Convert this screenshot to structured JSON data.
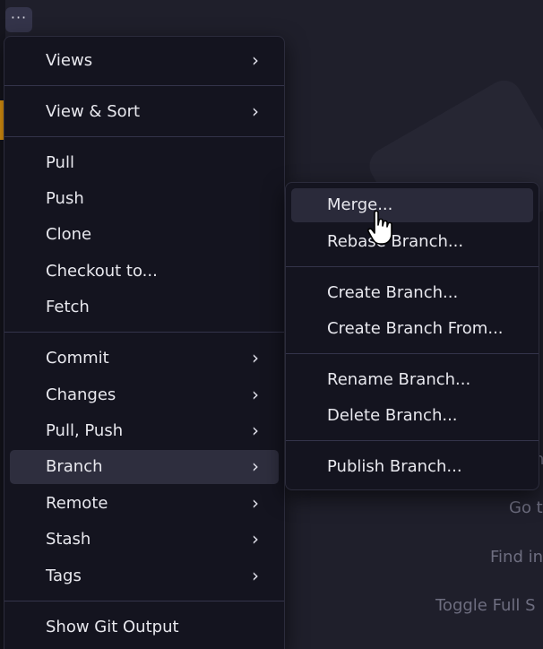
{
  "toolbar": {
    "more_label": "···"
  },
  "colors": {
    "menu_bg": "#14141f",
    "hover_bg": "#2e2e3e",
    "accent": "#f0a010"
  },
  "main_menu": {
    "items": [
      {
        "label": "Views",
        "submenu": true
      },
      {
        "label": "View & Sort",
        "submenu": true
      },
      {
        "label": "Pull",
        "submenu": false
      },
      {
        "label": "Push",
        "submenu": false
      },
      {
        "label": "Clone",
        "submenu": false
      },
      {
        "label": "Checkout to...",
        "submenu": false
      },
      {
        "label": "Fetch",
        "submenu": false
      },
      {
        "label": "Commit",
        "submenu": true
      },
      {
        "label": "Changes",
        "submenu": true
      },
      {
        "label": "Pull, Push",
        "submenu": true
      },
      {
        "label": "Branch",
        "submenu": true,
        "active": true
      },
      {
        "label": "Remote",
        "submenu": true
      },
      {
        "label": "Stash",
        "submenu": true
      },
      {
        "label": "Tags",
        "submenu": true
      },
      {
        "label": "Show Git Output",
        "submenu": false
      }
    ]
  },
  "branch_submenu": {
    "items": [
      {
        "label": "Merge...",
        "active": true
      },
      {
        "label": "Rebase Branch..."
      },
      {
        "label": "Create Branch..."
      },
      {
        "label": "Create Branch From..."
      },
      {
        "label": "Rename Branch..."
      },
      {
        "label": "Delete Branch..."
      },
      {
        "label": "Publish Branch..."
      }
    ]
  },
  "background_hints": {
    "hint_1": "n",
    "hint_2": "Go t",
    "hint_3": "Find in",
    "hint_4": "Toggle Full S"
  },
  "icons": {
    "chevron": "chevron-right-icon",
    "cursor": "hand-pointer-icon"
  }
}
